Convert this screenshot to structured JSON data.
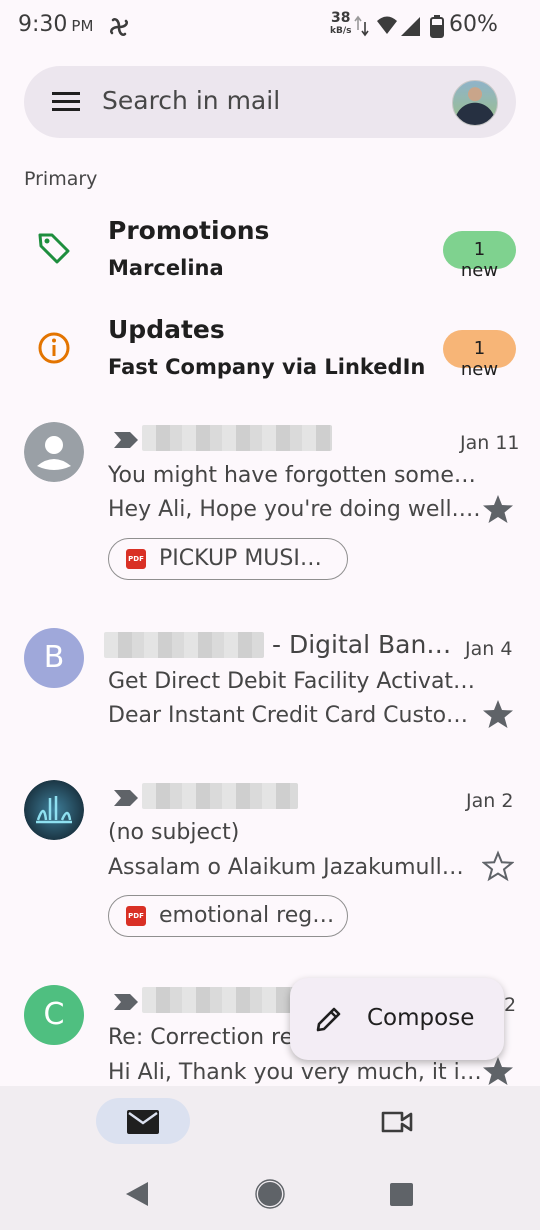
{
  "status_bar": {
    "time": "9:30",
    "ampm": "PM",
    "net_speed": "38",
    "net_speed_unit": "kB/s",
    "battery": "60%"
  },
  "search": {
    "placeholder": "Search in mail"
  },
  "section_label": "Primary",
  "categories": [
    {
      "title": "Promotions",
      "sender": "Marcelina",
      "badge": "1 new",
      "badge_color": "#7fd28f",
      "icon": "tag-icon",
      "icon_color": "#1e8e3e"
    },
    {
      "title": "Updates",
      "sender": "Fast Company via LinkedIn",
      "badge": "1 new",
      "badge_color": "#f7b577",
      "icon": "info-icon",
      "icon_color": "#e37400"
    }
  ],
  "emails": [
    {
      "sender_suffix": "",
      "date": "Jan 11",
      "subject": "You might have forgotten some…",
      "snippet": "Hey Ali, Hope you're doing well.…",
      "starred": true,
      "attachment": "PICKUP MUSI…",
      "avatar": "person-placeholder"
    },
    {
      "sender_suffix": "- Digital Ban…",
      "date": "Jan 4",
      "subject": "Get Direct Debit Facility Activat…",
      "snippet": "Dear Instant Credit Card Custo…",
      "starred": true,
      "avatar_letter": "B",
      "avatar_color": "#9fa8da"
    },
    {
      "sender_suffix": "",
      "date": "Jan 2",
      "subject": "(no subject)",
      "snippet": "Assalam o Alaikum Jazakumull…",
      "starred": false,
      "attachment": "emotional reg…",
      "avatar": "calligraphy-photo"
    },
    {
      "sender_suffix": "",
      "date": "2",
      "subject": "Re: Correction re",
      "snippet": "Hi Ali, Thank you very much, it i…",
      "starred": true,
      "avatar_letter": "C",
      "avatar_color": "#4fbf80"
    }
  ],
  "compose": {
    "label": "Compose"
  },
  "bottom_nav": {
    "tabs": [
      "mail-icon",
      "video-camera-icon"
    ],
    "active": "mail-icon"
  },
  "pdf_label": "PDF"
}
